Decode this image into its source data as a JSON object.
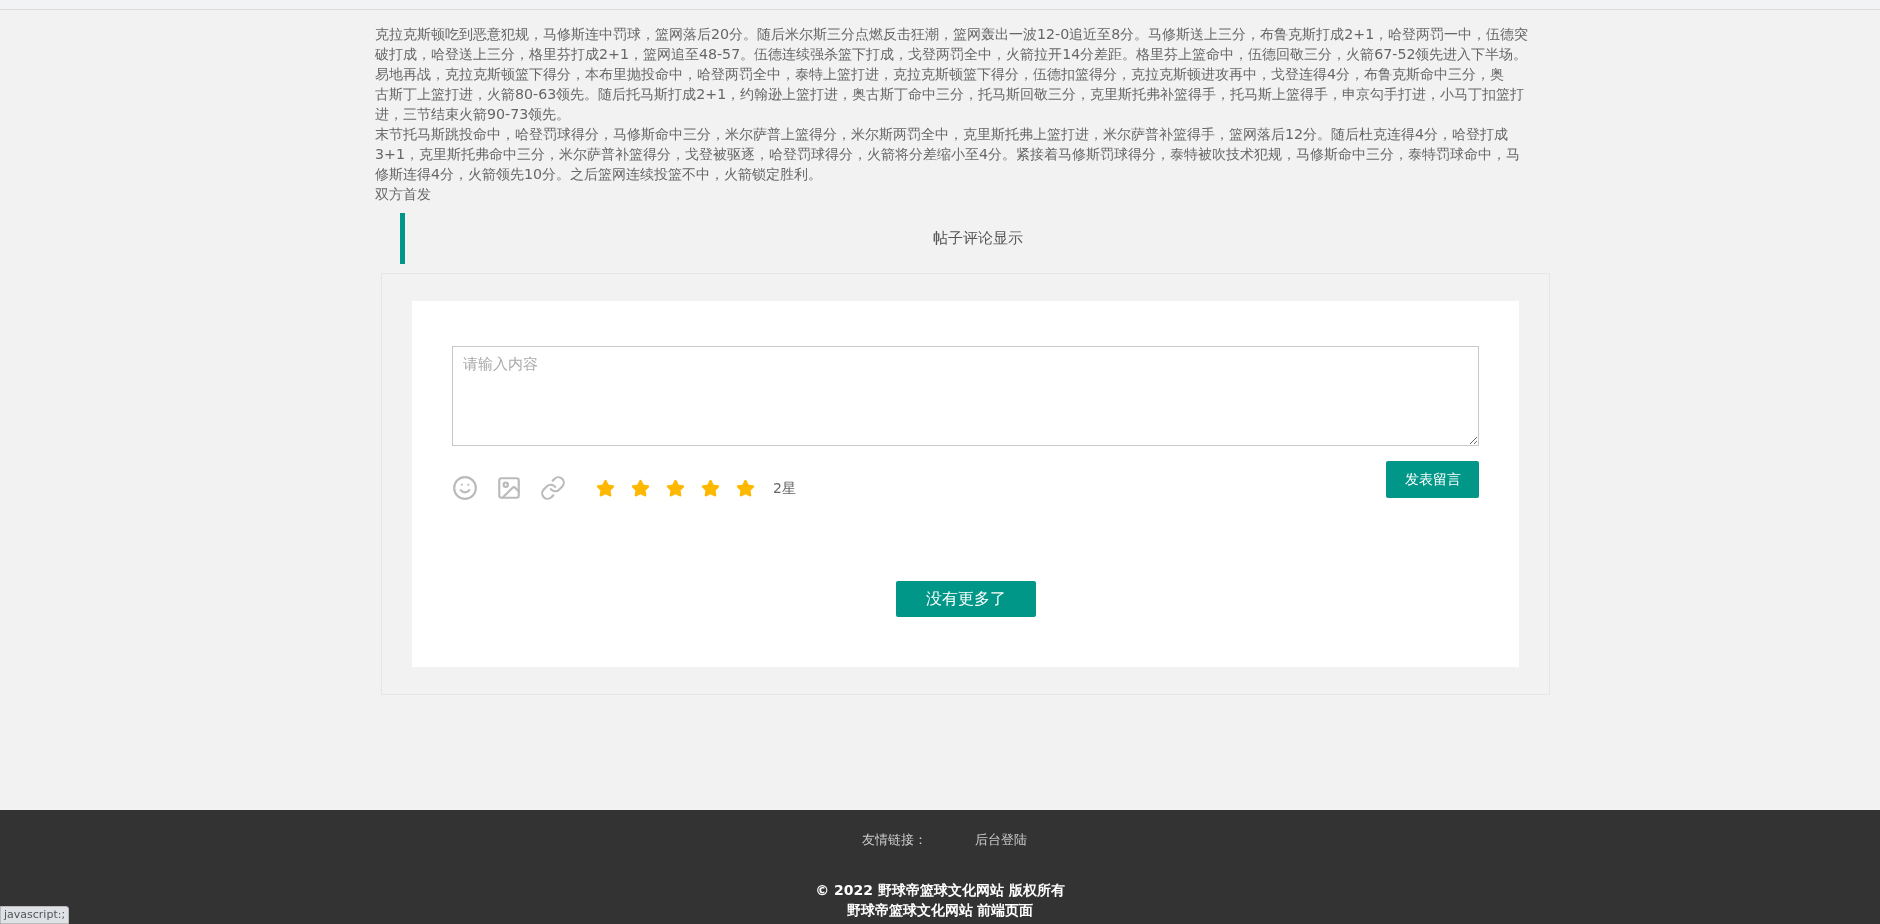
{
  "article": {
    "lines": [
      "克拉克斯顿吃到恶意犯规，马修斯连中罚球，篮网落后20分。随后米尔斯三分点燃反击狂潮，篮网轰出一波12-0追近至8分。马修斯送上三分，布鲁克斯打成2+1，哈登两罚一中，伍德突",
      "破打成，哈登送上三分，格里芬打成2+1，篮网追至48-57。伍德连续强杀篮下打成，戈登两罚全中，火箭拉开14分差距。格里芬上篮命中，伍德回敬三分，火箭67-52领先进入下半场。",
      "易地再战，克拉克斯顿篮下得分，本布里抛投命中，哈登两罚全中，泰特上篮打进，克拉克斯顿篮下得分，伍德扣篮得分，克拉克斯顿进攻再中，戈登连得4分，布鲁克斯命中三分，奥",
      "古斯丁上篮打进，火箭80-63领先。随后托马斯打成2+1，约翰逊上篮打进，奥古斯丁命中三分，托马斯回敬三分，克里斯托弗补篮得手，托马斯上篮得手，申京勾手打进，小马丁扣篮打",
      "进，三节结束火箭90-73领先。",
      "末节托马斯跳投命中，哈登罚球得分，马修斯命中三分，米尔萨普上篮得分，米尔斯两罚全中，克里斯托弗上篮打进，米尔萨普补篮得手，篮网落后12分。随后杜克连得4分，哈登打成",
      "3+1，克里斯托弗命中三分，米尔萨普补篮得分，戈登被驱逐，哈登罚球得分，火箭将分差缩小至4分。紧接着马修斯罚球得分，泰特被吹技术犯规，马修斯命中三分，泰特罚球命中，马",
      "修斯连得4分，火箭领先10分。之后篮网连续投篮不中，火箭锁定胜利。",
      "双方首发"
    ]
  },
  "comments": {
    "title": "帖子评论显示",
    "input": {
      "placeholder": "请输入内容"
    },
    "rating": {
      "stars": 5,
      "label": "2星"
    },
    "submit": "发表留言",
    "load_more": "没有更多了"
  },
  "footer": {
    "links_label": "友情链接：",
    "links": [
      "后台登陆"
    ],
    "copyright": "© 2022 野球帝篮球文化网站 版权所有",
    "subtitle": "野球帝篮球文化网站 前端页面"
  },
  "status_bar": "javascript:;"
}
